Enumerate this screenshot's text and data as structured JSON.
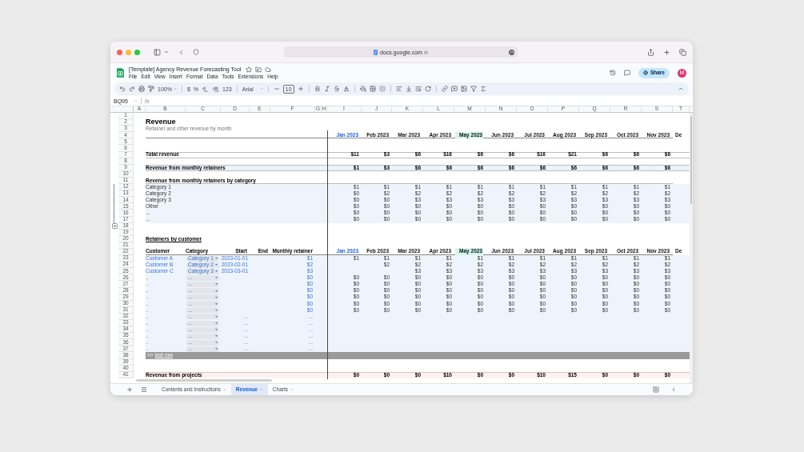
{
  "browser": {
    "address": "docs.google.com"
  },
  "document": {
    "title": "[Template] Agency Revenue Forecasting Tool",
    "menu": [
      "File",
      "Edit",
      "View",
      "Insert",
      "Format",
      "Data",
      "Tools",
      "Extensions",
      "Help"
    ],
    "share": "Share",
    "avatar": "M"
  },
  "toolbar": {
    "zoom": "100%",
    "currency": "$",
    "percent": "%",
    "number_format": "123",
    "font": "Arial",
    "font_size": "10"
  },
  "formula_bar": {
    "cell_ref": "BQ95",
    "fx": "fx"
  },
  "columns": [
    "A",
    "B",
    "C",
    "D",
    "E",
    "F",
    "G",
    "H",
    "I",
    "J",
    "K",
    "L",
    "M",
    "N",
    "O",
    "P",
    "Q",
    "R",
    "S",
    "T"
  ],
  "rows": [
    {
      "number": "1",
      "kind": "blank"
    },
    {
      "number": "2",
      "kind": "title",
      "label": "Revenue"
    },
    {
      "number": "3",
      "kind": "subtitle",
      "label": "Retainer and other revenue by month"
    },
    {
      "number": "4",
      "kind": "months",
      "months": [
        {
          "label": "Jan 2023",
          "accent": true,
          "highlighted": false
        },
        {
          "label": "Feb 2023",
          "accent": false,
          "highlighted": false
        },
        {
          "label": "Mar 2023",
          "accent": false,
          "highlighted": false
        },
        {
          "label": "Apr 2023",
          "accent": false,
          "highlighted": false
        },
        {
          "label": "May 2023",
          "accent": false,
          "highlighted": true
        },
        {
          "label": "Jun 2023",
          "accent": false,
          "highlighted": false
        },
        {
          "label": "Jul 2023",
          "accent": false,
          "highlighted": false
        },
        {
          "label": "Aug 2023",
          "accent": false,
          "highlighted": false
        },
        {
          "label": "Sep 2023",
          "accent": false,
          "highlighted": false
        },
        {
          "label": "Oct 2023",
          "accent": false,
          "highlighted": false
        },
        {
          "label": "Nov 2023",
          "accent": false,
          "highlighted": false
        },
        {
          "label": "De",
          "accent": false,
          "highlighted": false
        }
      ]
    },
    {
      "number": "5",
      "kind": "blank"
    },
    {
      "number": "6",
      "kind": "blank"
    },
    {
      "number": "7",
      "kind": "total",
      "label": "Total revenue",
      "values": [
        "$11",
        "$3",
        "$6",
        "$16",
        "$6",
        "$6",
        "$16",
        "$21",
        "$6",
        "$6",
        "$6"
      ]
    },
    {
      "number": "8",
      "kind": "blank"
    },
    {
      "number": "9",
      "kind": "subtotal",
      "label": "Revenue from monthly retainers",
      "values": [
        "$1",
        "$3",
        "$6",
        "$6",
        "$6",
        "$6",
        "$6",
        "$6",
        "$6",
        "$6",
        "$6"
      ]
    },
    {
      "number": "10",
      "kind": "blank"
    },
    {
      "number": "11",
      "kind": "heading",
      "label": "Revenue from monthly retainers by category"
    },
    {
      "number": "12",
      "kind": "category",
      "grouped": true,
      "label": "Category 1",
      "values": [
        "$1",
        "$1",
        "$1",
        "$1",
        "$1",
        "$1",
        "$1",
        "$1",
        "$1",
        "$1",
        "$1"
      ]
    },
    {
      "number": "13",
      "kind": "category",
      "grouped": true,
      "label": "Category 2",
      "values": [
        "$0",
        "$2",
        "$2",
        "$2",
        "$2",
        "$2",
        "$2",
        "$2",
        "$2",
        "$2",
        "$2"
      ]
    },
    {
      "number": "14",
      "kind": "category",
      "grouped": true,
      "label": "Category 3",
      "values": [
        "$0",
        "$0",
        "$3",
        "$3",
        "$3",
        "$3",
        "$3",
        "$3",
        "$3",
        "$3",
        "$3"
      ]
    },
    {
      "number": "15",
      "kind": "category",
      "grouped": true,
      "label": "Other",
      "values": [
        "$0",
        "$0",
        "$0",
        "$0",
        "$0",
        "$0",
        "$0",
        "$0",
        "$0",
        "$0",
        "$0"
      ]
    },
    {
      "number": "16",
      "kind": "category",
      "grouped": true,
      "label": "...",
      "values": [
        "$0",
        "$0",
        "$0",
        "$0",
        "$0",
        "$0",
        "$0",
        "$0",
        "$0",
        "$0",
        "$0"
      ]
    },
    {
      "number": "17",
      "kind": "category",
      "grouped": true,
      "label": "...",
      "values": [
        "$0",
        "$0",
        "$0",
        "$0",
        "$0",
        "$0",
        "$0",
        "$0",
        "$0",
        "$0",
        "$0"
      ]
    },
    {
      "number": "18",
      "kind": "blank",
      "group_toggle": {
        "expanded": true
      }
    },
    {
      "number": "19",
      "kind": "blank"
    },
    {
      "number": "20",
      "kind": "section",
      "label": "Retainers by customer"
    },
    {
      "number": "21",
      "kind": "blank"
    },
    {
      "number": "22",
      "kind": "customer_header",
      "columns": [
        "Customer",
        "Category",
        "Start",
        "End",
        "Monthly retainer"
      ],
      "months": [
        {
          "label": "Jan 2023",
          "accent": true,
          "highlighted": false
        },
        {
          "label": "Feb 2023",
          "accent": false,
          "highlighted": false
        },
        {
          "label": "Mar 2023",
          "accent": false,
          "highlighted": false
        },
        {
          "label": "Apr 2023",
          "accent": false,
          "highlighted": false
        },
        {
          "label": "May 2023",
          "accent": false,
          "highlighted": true
        },
        {
          "label": "Jun 2023",
          "accent": false,
          "highlighted": false
        },
        {
          "label": "Jul 2023",
          "accent": false,
          "highlighted": false
        },
        {
          "label": "Aug 2023",
          "accent": false,
          "highlighted": false
        },
        {
          "label": "Sep 2023",
          "accent": false,
          "highlighted": false
        },
        {
          "label": "Oct 2023",
          "accent": false,
          "highlighted": false
        },
        {
          "label": "Nov 2023",
          "accent": false,
          "highlighted": false
        },
        {
          "label": "De",
          "accent": false,
          "highlighted": false
        }
      ]
    },
    {
      "number": "23",
      "kind": "customer",
      "customer": "Customer A",
      "category": "Category 1",
      "start": "2023-01-01",
      "retainer": "$1",
      "values": [
        "$1",
        "$1",
        "$1",
        "$1",
        "$1",
        "$1",
        "$1",
        "$1",
        "$1",
        "$1",
        "$1"
      ]
    },
    {
      "number": "24",
      "kind": "customer",
      "customer": "Customer B",
      "category": "Category 2",
      "start": "2023-02-01",
      "retainer": "$2",
      "values": [
        "$2",
        "$2",
        "$2",
        "$2",
        "$2",
        "$2",
        "$2",
        "$2",
        "$2",
        "$2"
      ]
    },
    {
      "number": "25",
      "kind": "customer",
      "customer": "Customer C",
      "category": "Category 3",
      "start": "2023-03-01",
      "retainer": "$3",
      "values": [
        "$3",
        "$3",
        "$3",
        "$3",
        "$3",
        "$3",
        "$3",
        "$3",
        "$3"
      ]
    },
    {
      "number": "26",
      "kind": "customer",
      "customer": "..",
      "category": "...",
      "retainer": "$0",
      "values": [
        "$0",
        "$0",
        "$0",
        "$0",
        "$0",
        "$0",
        "$0",
        "$0",
        "$0",
        "$0",
        "$0"
      ]
    },
    {
      "number": "27",
      "kind": "customer",
      "customer": "..",
      "category": "...",
      "retainer": "$0",
      "values": [
        "$0",
        "$0",
        "$0",
        "$0",
        "$0",
        "$0",
        "$0",
        "$0",
        "$0",
        "$0",
        "$0"
      ]
    },
    {
      "number": "28",
      "kind": "customer",
      "customer": "..",
      "category": "...",
      "retainer": "$0",
      "values": [
        "$0",
        "$0",
        "$0",
        "$0",
        "$0",
        "$0",
        "$0",
        "$0",
        "$0",
        "$0",
        "$0"
      ]
    },
    {
      "number": "29",
      "kind": "customer",
      "customer": "..",
      "category": "...",
      "retainer": "$0",
      "values": [
        "$0",
        "$0",
        "$0",
        "$0",
        "$0",
        "$0",
        "$0",
        "$0",
        "$0",
        "$0",
        "$0"
      ]
    },
    {
      "number": "30",
      "kind": "customer",
      "customer": "..",
      "category": "...",
      "retainer": "$0",
      "values": [
        "$0",
        "$0",
        "$0",
        "$0",
        "$0",
        "$0",
        "$0",
        "$0",
        "$0",
        "$0",
        "$0"
      ]
    },
    {
      "number": "31",
      "kind": "customer",
      "customer": "..",
      "category": "...",
      "retainer": "$0",
      "values": [
        "$0",
        "$0",
        "$0",
        "$0",
        "$0",
        "$0",
        "$0",
        "$0",
        "$0",
        "$0",
        "$0"
      ]
    },
    {
      "number": "32",
      "kind": "customer",
      "customer": "..",
      "category": "...",
      "start": "...",
      "retainer": "..."
    },
    {
      "number": "33",
      "kind": "customer",
      "customer": "..",
      "category": "...",
      "start": "...",
      "retainer": "..."
    },
    {
      "number": "34",
      "kind": "customer",
      "customer": "..",
      "category": "...",
      "start": "...",
      "retainer": "..."
    },
    {
      "number": "35",
      "kind": "customer",
      "customer": "..",
      "category": "...",
      "start": "...",
      "retainer": "..."
    },
    {
      "number": "36",
      "kind": "customer",
      "customer": "..",
      "category": "...",
      "start": "...",
      "retainer": "..."
    },
    {
      "number": "37",
      "kind": "customer",
      "customer": "..",
      "category": "...",
      "start": "...",
      "retainer": "..."
    },
    {
      "number": "38",
      "kind": "last_row",
      "marker": ">>",
      "label": "last row"
    },
    {
      "number": "39",
      "kind": "blank"
    },
    {
      "number": "40",
      "kind": "blank"
    },
    {
      "number": "41",
      "kind": "projects",
      "label": "Revenue from projects",
      "values": [
        "$0",
        "$0",
        "$0",
        "$10",
        "$0",
        "$0",
        "$10",
        "$15",
        "$0",
        "$0",
        "$0"
      ]
    }
  ],
  "sheet_tabs": [
    {
      "label": "Contents and Instructions",
      "selected": false
    },
    {
      "label": "Revenue",
      "selected": true
    },
    {
      "label": "Charts",
      "selected": false
    }
  ]
}
